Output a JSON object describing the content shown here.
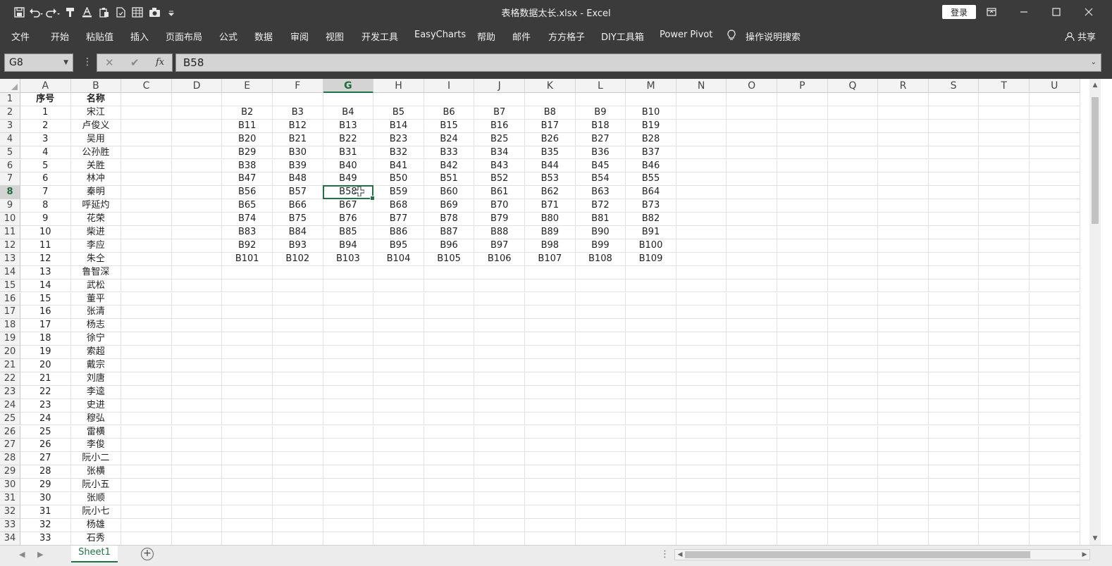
{
  "window": {
    "title": "表格数据太长.xlsx  -  Excel",
    "login_label": "登录"
  },
  "quick_access": [
    "save-icon",
    "undo-icon",
    "redo-icon",
    "format-painter-icon",
    "font-color-icon",
    "paste-icon",
    "document-icon",
    "table-icon",
    "camera-icon",
    "customize-icon"
  ],
  "menu": {
    "items": [
      "文件",
      "开始",
      "粘贴值",
      "插入",
      "页面布局",
      "公式",
      "数据",
      "审阅",
      "视图",
      "开发工具",
      "EasyCharts",
      "帮助",
      "邮件",
      "方方格子",
      "DIY工具箱",
      "Power Pivot",
      "操作说明搜索"
    ],
    "share_label": "共享"
  },
  "formula_bar": {
    "name_box": "G8",
    "cancel_symbol": "✕",
    "enter_symbol": "✔",
    "fx_symbol": "fx",
    "content": "B58"
  },
  "columns": [
    "A",
    "B",
    "C",
    "D",
    "E",
    "F",
    "G",
    "H",
    "I",
    "J",
    "K",
    "L",
    "M",
    "N",
    "O",
    "P",
    "Q",
    "R",
    "S",
    "T",
    "U"
  ],
  "selected_column": "G",
  "selected_row": 8,
  "row_numbers": [
    1,
    2,
    3,
    4,
    5,
    6,
    7,
    8,
    9,
    10,
    11,
    12,
    13,
    14,
    15,
    16,
    17,
    18,
    19,
    20,
    21,
    22,
    23,
    24,
    25,
    26,
    27,
    28,
    29,
    30,
    31,
    32,
    33,
    34
  ],
  "sheet": {
    "col_a_header": "序号",
    "col_b_header": "名称",
    "names": [
      "宋江",
      "卢俊义",
      "吴用",
      "公孙胜",
      "关胜",
      "林冲",
      "秦明",
      "呼延灼",
      "花荣",
      "柴进",
      "李应",
      "朱仝",
      "鲁智深",
      "武松",
      "董平",
      "张清",
      "杨志",
      "徐宁",
      "索超",
      "戴宗",
      "刘唐",
      "李逵",
      "史进",
      "穆弘",
      "雷横",
      "李俊",
      "阮小二",
      "张横",
      "阮小五",
      "张顺",
      "阮小七",
      "杨雄",
      "石秀"
    ],
    "matrix": [
      [
        "B2",
        "B3",
        "B4",
        "B5",
        "B6",
        "B7",
        "B8",
        "B9",
        "B10"
      ],
      [
        "B11",
        "B12",
        "B13",
        "B14",
        "B15",
        "B16",
        "B17",
        "B18",
        "B19"
      ],
      [
        "B20",
        "B21",
        "B22",
        "B23",
        "B24",
        "B25",
        "B26",
        "B27",
        "B28"
      ],
      [
        "B29",
        "B30",
        "B31",
        "B32",
        "B33",
        "B34",
        "B35",
        "B36",
        "B37"
      ],
      [
        "B38",
        "B39",
        "B40",
        "B41",
        "B42",
        "B43",
        "B44",
        "B45",
        "B46"
      ],
      [
        "B47",
        "B48",
        "B49",
        "B50",
        "B51",
        "B52",
        "B53",
        "B54",
        "B55"
      ],
      [
        "B56",
        "B57",
        "B58",
        "B59",
        "B60",
        "B61",
        "B62",
        "B63",
        "B64"
      ],
      [
        "B65",
        "B66",
        "B67",
        "B68",
        "B69",
        "B70",
        "B71",
        "B72",
        "B73"
      ],
      [
        "B74",
        "B75",
        "B76",
        "B77",
        "B78",
        "B79",
        "B80",
        "B81",
        "B82"
      ],
      [
        "B83",
        "B84",
        "B85",
        "B86",
        "B87",
        "B88",
        "B89",
        "B90",
        "B91"
      ],
      [
        "B92",
        "B93",
        "B94",
        "B95",
        "B96",
        "B97",
        "B98",
        "B99",
        "B100"
      ],
      [
        "B101",
        "B102",
        "B103",
        "B104",
        "B105",
        "B106",
        "B107",
        "B108",
        "B109"
      ]
    ]
  },
  "sheet_tabs": [
    "Sheet1"
  ],
  "colors": {
    "accent": "#217346",
    "chrome": "#3b3b3b"
  }
}
